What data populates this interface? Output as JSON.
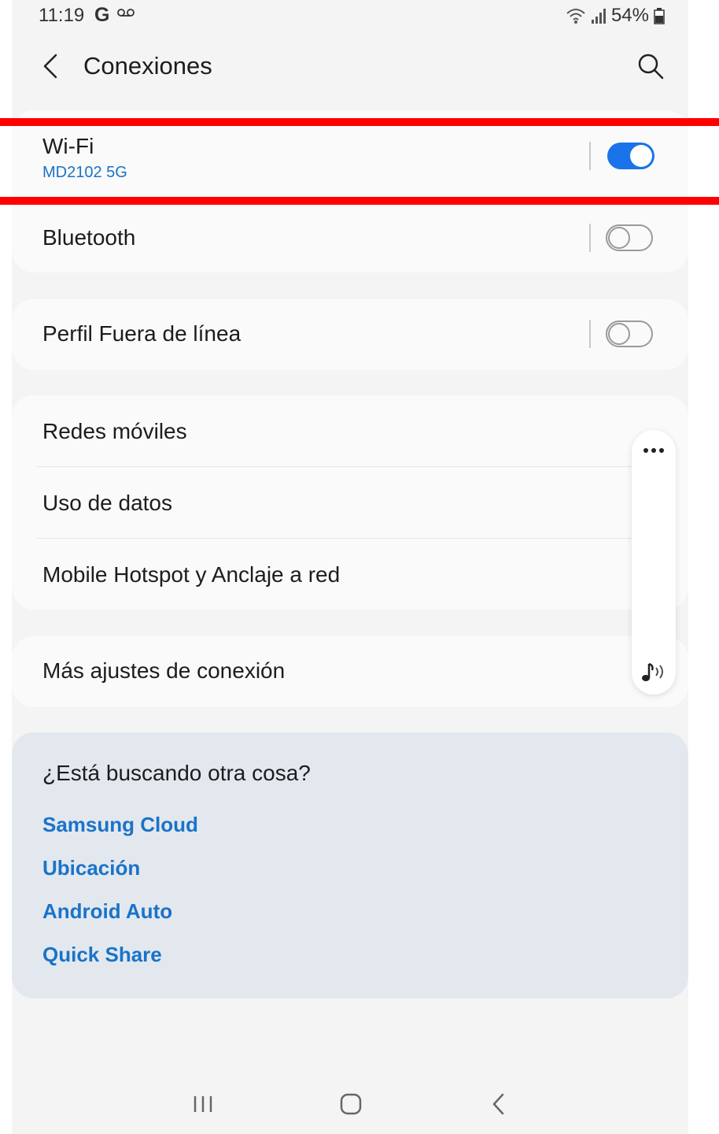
{
  "status_bar": {
    "time": "11:19",
    "carrier_letter": "G",
    "battery_text": "54%"
  },
  "app_bar": {
    "title": "Conexiones"
  },
  "settings": {
    "wifi": {
      "label": "Wi-Fi",
      "network": "MD2102 5G",
      "enabled": true
    },
    "bluetooth": {
      "label": "Bluetooth",
      "enabled": false
    },
    "offline": {
      "label": "Perfil Fuera de línea",
      "enabled": false
    },
    "network_group": [
      {
        "label": "Redes móviles"
      },
      {
        "label": "Uso de datos"
      },
      {
        "label": "Mobile Hotspot y Anclaje a red"
      }
    ],
    "more": {
      "label": "Más ajustes de conexión"
    }
  },
  "suggestions": {
    "title": "¿Está buscando otra cosa?",
    "links": [
      "Samsung Cloud",
      "Ubicación",
      "Android Auto",
      "Quick Share"
    ]
  },
  "colors": {
    "accent": "#1a73e8",
    "link": "#1a73c8",
    "highlight": "#ff0000",
    "suggest_bg": "#e3e8ef"
  },
  "icons": {
    "back": "chevron-left-icon",
    "search": "search-icon",
    "more": "more-dots-icon",
    "sound": "music-note-icon",
    "nav_recents": "recents-icon",
    "nav_home": "home-icon",
    "nav_back": "nav-back-icon"
  }
}
